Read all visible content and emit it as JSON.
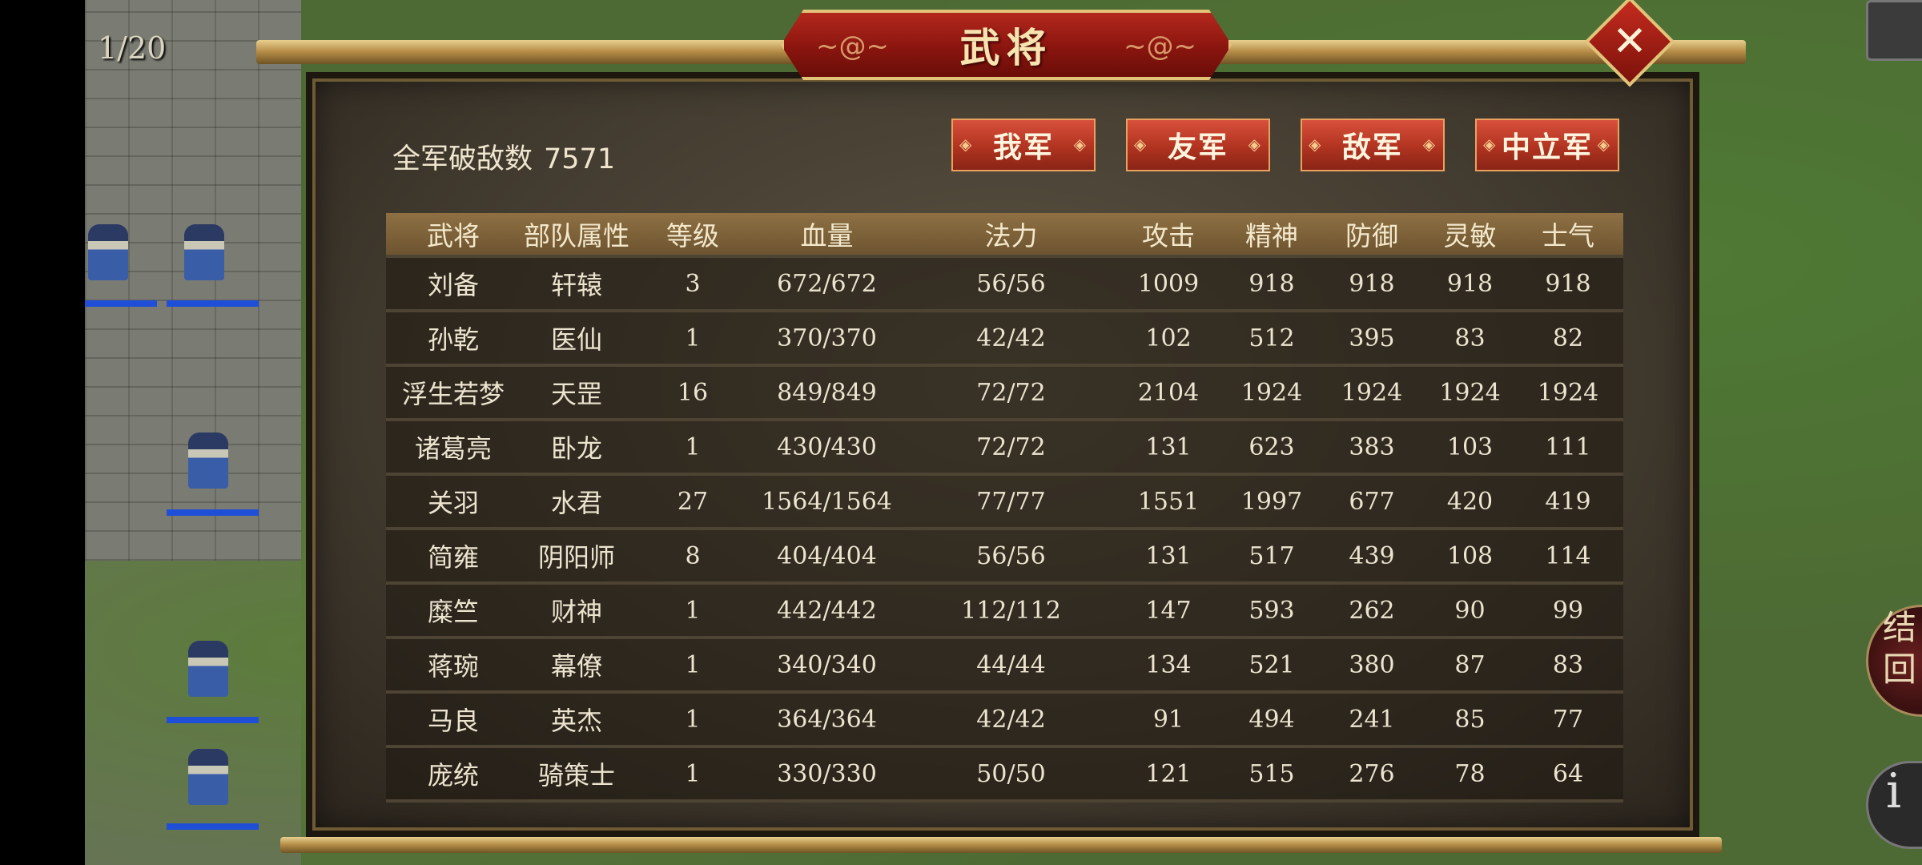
{
  "hud": {
    "page_counter": "1/20",
    "side_button_label": "结回",
    "info_button_label": "i"
  },
  "dialog": {
    "title": "武将",
    "close_label": "✕",
    "kills_label": "全军破敌数",
    "kills_value": "7571",
    "tabs": [
      {
        "label": "我军",
        "selected": true
      },
      {
        "label": "友军",
        "selected": false
      },
      {
        "label": "敌军",
        "selected": false
      },
      {
        "label": "中立军",
        "selected": false
      }
    ],
    "table": {
      "headers": [
        "武将",
        "部队属性",
        "等级",
        "血量",
        "法力",
        "攻击",
        "精神",
        "防御",
        "灵敏",
        "士气"
      ],
      "rows": [
        [
          "刘备",
          "轩辕",
          "3",
          "672/672",
          "56/56",
          "1009",
          "918",
          "918",
          "918",
          "918"
        ],
        [
          "孙乾",
          "医仙",
          "1",
          "370/370",
          "42/42",
          "102",
          "512",
          "395",
          "83",
          "82"
        ],
        [
          "浮生若梦",
          "天罡",
          "16",
          "849/849",
          "72/72",
          "2104",
          "1924",
          "1924",
          "1924",
          "1924"
        ],
        [
          "诸葛亮",
          "卧龙",
          "1",
          "430/430",
          "72/72",
          "131",
          "623",
          "383",
          "103",
          "111"
        ],
        [
          "关羽",
          "水君",
          "27",
          "1564/1564",
          "77/77",
          "1551",
          "1997",
          "677",
          "420",
          "419"
        ],
        [
          "简雍",
          "阴阳师",
          "8",
          "404/404",
          "56/56",
          "131",
          "517",
          "439",
          "108",
          "114"
        ],
        [
          "糜竺",
          "财神",
          "1",
          "442/442",
          "112/112",
          "147",
          "593",
          "262",
          "90",
          "99"
        ],
        [
          "蒋琬",
          "幕僚",
          "1",
          "340/340",
          "44/44",
          "134",
          "521",
          "380",
          "87",
          "83"
        ],
        [
          "马良",
          "英杰",
          "1",
          "364/364",
          "42/42",
          "91",
          "494",
          "241",
          "85",
          "77"
        ],
        [
          "庞统",
          "骑策士",
          "1",
          "330/330",
          "50/50",
          "121",
          "515",
          "276",
          "78",
          "64"
        ]
      ]
    }
  },
  "colors": {
    "accent_red": "#b03320",
    "frame_gold": "#e3c27a",
    "title_text": "#f6e3b0"
  }
}
